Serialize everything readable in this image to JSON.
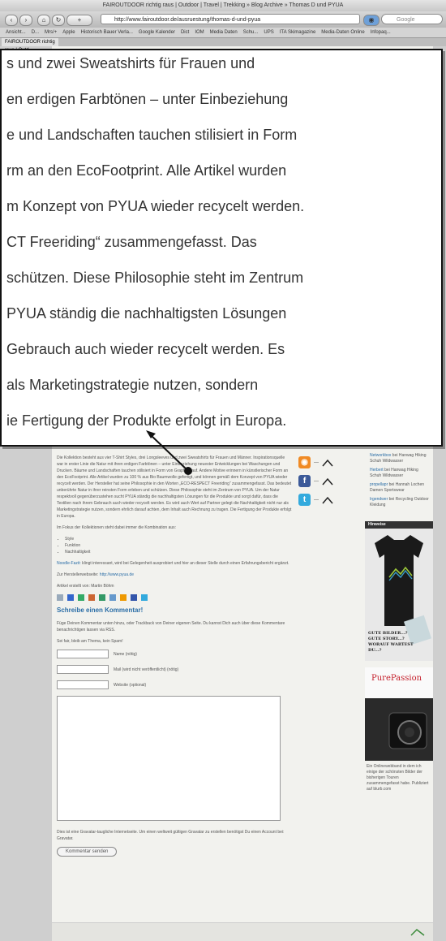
{
  "browser": {
    "window_title": "FAIROUTDOOR richtig raus | Outdoor | Travel | Trekking » Blog Archive » Thomas D und PYUA",
    "url": "http://www.fairoutdoor.de/ausruestung/thomas-d-und-pyua",
    "search_placeholder": "Google",
    "bookmarks": [
      "Ansicht...",
      "D...",
      "Mrs/+",
      "Apple",
      "Historisch Bauer Verla...",
      "Google Kalender",
      "Dict",
      "IOM",
      "Media Daten",
      "Schu...",
      "UPS",
      "ITA Skimagazine",
      "Media-Daten Online",
      "Infopaq..."
    ],
    "tab_label": "FAIROUTDOOR richtig raus | Outd..."
  },
  "zoom": {
    "lines": [
      "s und zwei Sweatshirts für Frauen und",
      "en erdigen Farbtönen – unter Einbeziehung",
      "e und Landschaften tauchen stilisiert in Form",
      "rm an den EcoFootprint. Alle Artikel wurden",
      "m Konzept von PYUA wieder recycelt werden.",
      "CT Freeriding“ zusammengefasst. Das",
      "schützen. Diese Philosophie steht im Zentrum",
      " PYUA ständig die nachhaltigsten Lösungen",
      " Gebrauch auch wieder recycelt werden. Es",
      "als Marketingstrategie nutzen, sondern",
      "ie Fertigung der Produkte erfolgt in Europa."
    ]
  },
  "article": {
    "paragraph": "Die Kollektion besteht aus vier T-Shirt Styles, drei Longsleeves und zwei Sweatshirts für Frauen und Männer. Inspirationsquelle war in erster Linie die Natur mit ihren erdigen Farbtönen – unter Einbeziehung neuester Entwicklungen bei Waschungen und Drucken. Bäume und Landschaften tauchen stilisiert in Form von Graphics auf. Andere Motive erinnern in künstlerischer Form an den EcoFootprint. Alle Artikel wurden zu 100 % aus Bio Baumwolle gefertigt, und können gemäß dem Konzept von PYUA wieder recycelt werden. Der Hersteller hat seine Philosophie in den Worten „ECO-RESPECT Freeriding“ zusammengefasst. Das bedeutet unberührte Natur in ihrer reinsten Form erleben und schützen. Diese Philosophie steht im Zentrum von PYUA. Um der Natur respektvoll gegenüberzustehen sucht PYUA ständig die nachhaltigsten Lösungen für die Produkte und sorgt dafür, dass die Textilien nach ihrem Gebrauch auch wieder recycelt werden. Es wird auch Wert auf Partner gelegt die Nachhaltigkeit nicht nur als Marketingstrategie nutzen, sondern ehrlich darauf achten, dem Inhalt auch Rechnung zu tragen. Die Fertigung der Produkte erfolgt in Europa.",
    "focus_intro": "Im Fokus der Kollektionen steht dabei immer die Kombination aus:",
    "focus_items": [
      "Style",
      "Funktion",
      "Nachhaltigkeit"
    ],
    "noodle_lead": "Noodle-Fazit:",
    "noodle_text": " klingt interessant, wird bei Gelegenheit ausprobiert und hier an dieser Stelle durch einen Erfahrungsbericht ergänzt.",
    "maker_label": "Zur Herstellerwebseite: ",
    "maker_link": "http://www.pyua.de",
    "author": "Artikel erstellt von: Martin Böhm"
  },
  "comments": {
    "heading": "Schreibe einen Kommentar!",
    "intro": "Füge Deinen Kommentar unten hinzu, oder Trackback von Deiner eigenen Seite. Du kannst Dich auch über diese Kommentare benachrichtigen lassen via RSS.",
    "nice": "Sei fair, bleib am Thema, kein Spam!",
    "fields": [
      {
        "label": "Name (nötig)"
      },
      {
        "label": "Mail (wird nicht veröffentlicht) (nötig)"
      },
      {
        "label": "Website (optional)"
      }
    ],
    "gravatar": "Dies ist eine Gravatar-taugliche Internetseite. Um einen weltweit gültigen Gravatar zu erstellen benötigst Du einen Account bei: Gravatar.",
    "submit": "Kommentar senden"
  },
  "sidebar": {
    "social": [
      {
        "name": "rss-icon",
        "color": "#f08a24",
        "glyph": "◉",
        "label": "—"
      },
      {
        "name": "facebook-icon",
        "color": "#3b5998",
        "glyph": "f",
        "label": "—"
      },
      {
        "name": "twitter-icon",
        "color": "#33aadd",
        "glyph": "t",
        "label": "—"
      }
    ],
    "recent": [
      {
        "who": "Networkbox",
        "text": " bei Hanwag Hiking Schuh Wildwasser"
      },
      {
        "who": "Herbert",
        "text": " bei Hanwag Hiking Schuh Wildwasser"
      },
      {
        "who": "propellapr",
        "text": " bei Hannah Lochen Damen Sportswear"
      },
      {
        "who": "Irgendwer",
        "text": " bei Recycling Outdoor Kleidung"
      }
    ],
    "hinweise": "Hinweise",
    "shirt_text": "GUTE BILDER...? GUTE STORY...? WORAUF WARTEST DU...?",
    "pp_logo": "PurePassion",
    "pp_caption": "Ein Onlinewebband in dem ich einige der schönsten Bilder der bisherigen Touren zusammengefasst habe. Publiziert auf blurb.com"
  }
}
